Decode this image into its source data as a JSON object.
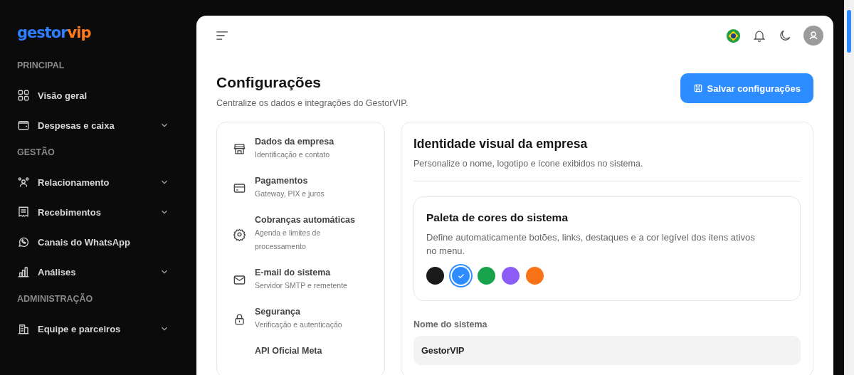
{
  "logo": {
    "part_1": "gestor",
    "part_2": "vip"
  },
  "sidebar": {
    "sections": [
      {
        "title": "PRINCIPAL",
        "items": [
          {
            "label": "Visão geral",
            "has_submenu": false
          },
          {
            "label": "Despesas e caixa",
            "has_submenu": true
          }
        ]
      },
      {
        "title": "GESTÃO",
        "items": [
          {
            "label": "Relacionamento",
            "has_submenu": true
          },
          {
            "label": "Recebimentos",
            "has_submenu": true
          },
          {
            "label": "Canais do WhatsApp",
            "has_submenu": false
          },
          {
            "label": "Análises",
            "has_submenu": true
          }
        ]
      },
      {
        "title": "ADMINISTRAÇÃO",
        "items": [
          {
            "label": "Equipe e parceiros",
            "has_submenu": true
          }
        ]
      }
    ]
  },
  "header": {
    "title": "Configurações",
    "subtitle": "Centralize os dados e integrações do GestorVIP.",
    "save_button": "Salvar configurações"
  },
  "settings_nav": [
    {
      "title": "Dados da empresa",
      "subtitle": "Identificação e contato"
    },
    {
      "title": "Pagamentos",
      "subtitle": "Gateway, PIX e juros"
    },
    {
      "title": "Cobranças automáticas",
      "subtitle": "Agenda e limites de processamento"
    },
    {
      "title": "E-mail do sistema",
      "subtitle": "Servidor SMTP e remetente"
    },
    {
      "title": "Segurança",
      "subtitle": "Verificação e autenticação"
    },
    {
      "title": "API Oficial Meta"
    }
  ],
  "panel": {
    "title": "Identidade visual da empresa",
    "subtitle": "Personalize o nome, logotipo e ícone exibidos no sistema.",
    "palette": {
      "title": "Paleta de cores do sistema",
      "description": "Define automaticamente botões, links, destaques e a cor legível dos itens ativos no menu.",
      "colors": [
        {
          "color": "#1a1a1a",
          "selected": false
        },
        {
          "color": "#2d8cff",
          "selected": true
        },
        {
          "color": "#16a34a",
          "selected": false
        },
        {
          "color": "#8b5cf6",
          "selected": false
        },
        {
          "color": "#f97316",
          "selected": false
        }
      ]
    },
    "field": {
      "label": "Nome do sistema",
      "value": "GestorVIP"
    }
  }
}
